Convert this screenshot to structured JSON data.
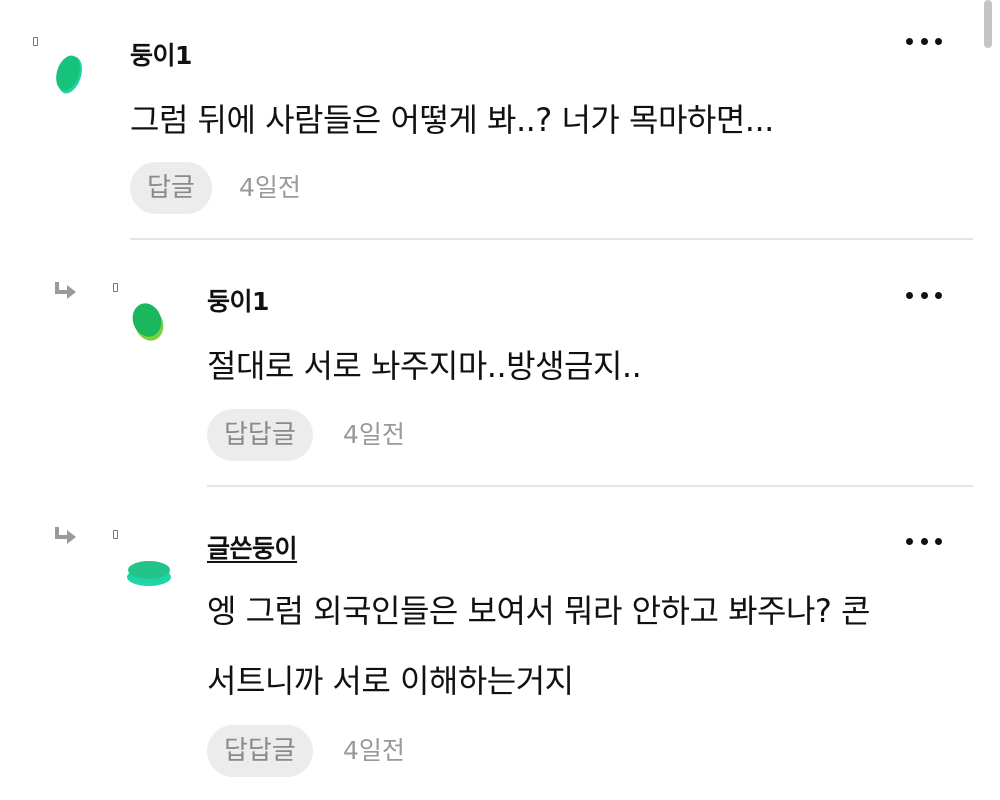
{
  "comments": [
    {
      "username": "둥이1",
      "text": "그럼 뒤에 사람들은 어떻게 봐..? 너가 목마하면...",
      "reply_label": "답글",
      "time": "4일전"
    },
    {
      "username": "둥이1",
      "text": "절대로 서로 놔주지마..방생금지..",
      "reply_label": "답답글",
      "time": "4일전"
    },
    {
      "username": "글쓴둥이",
      "text_lines": [
        "엥 그럼 외국인들은 보여서 뭐라 안하고 봐주나? 콘",
        "서트니까 서로 이해하는거지"
      ],
      "reply_label": "답답글",
      "time": "4일전"
    }
  ],
  "icons": {
    "avatar": "green-blob-avatar",
    "more": "more-dots-icon",
    "reply": "reply-arrow-icon"
  },
  "colors": {
    "avatar_green": "#1fc47e",
    "avatar_lime": "#7fd13b",
    "avatar_teal": "#1ed4a5"
  }
}
